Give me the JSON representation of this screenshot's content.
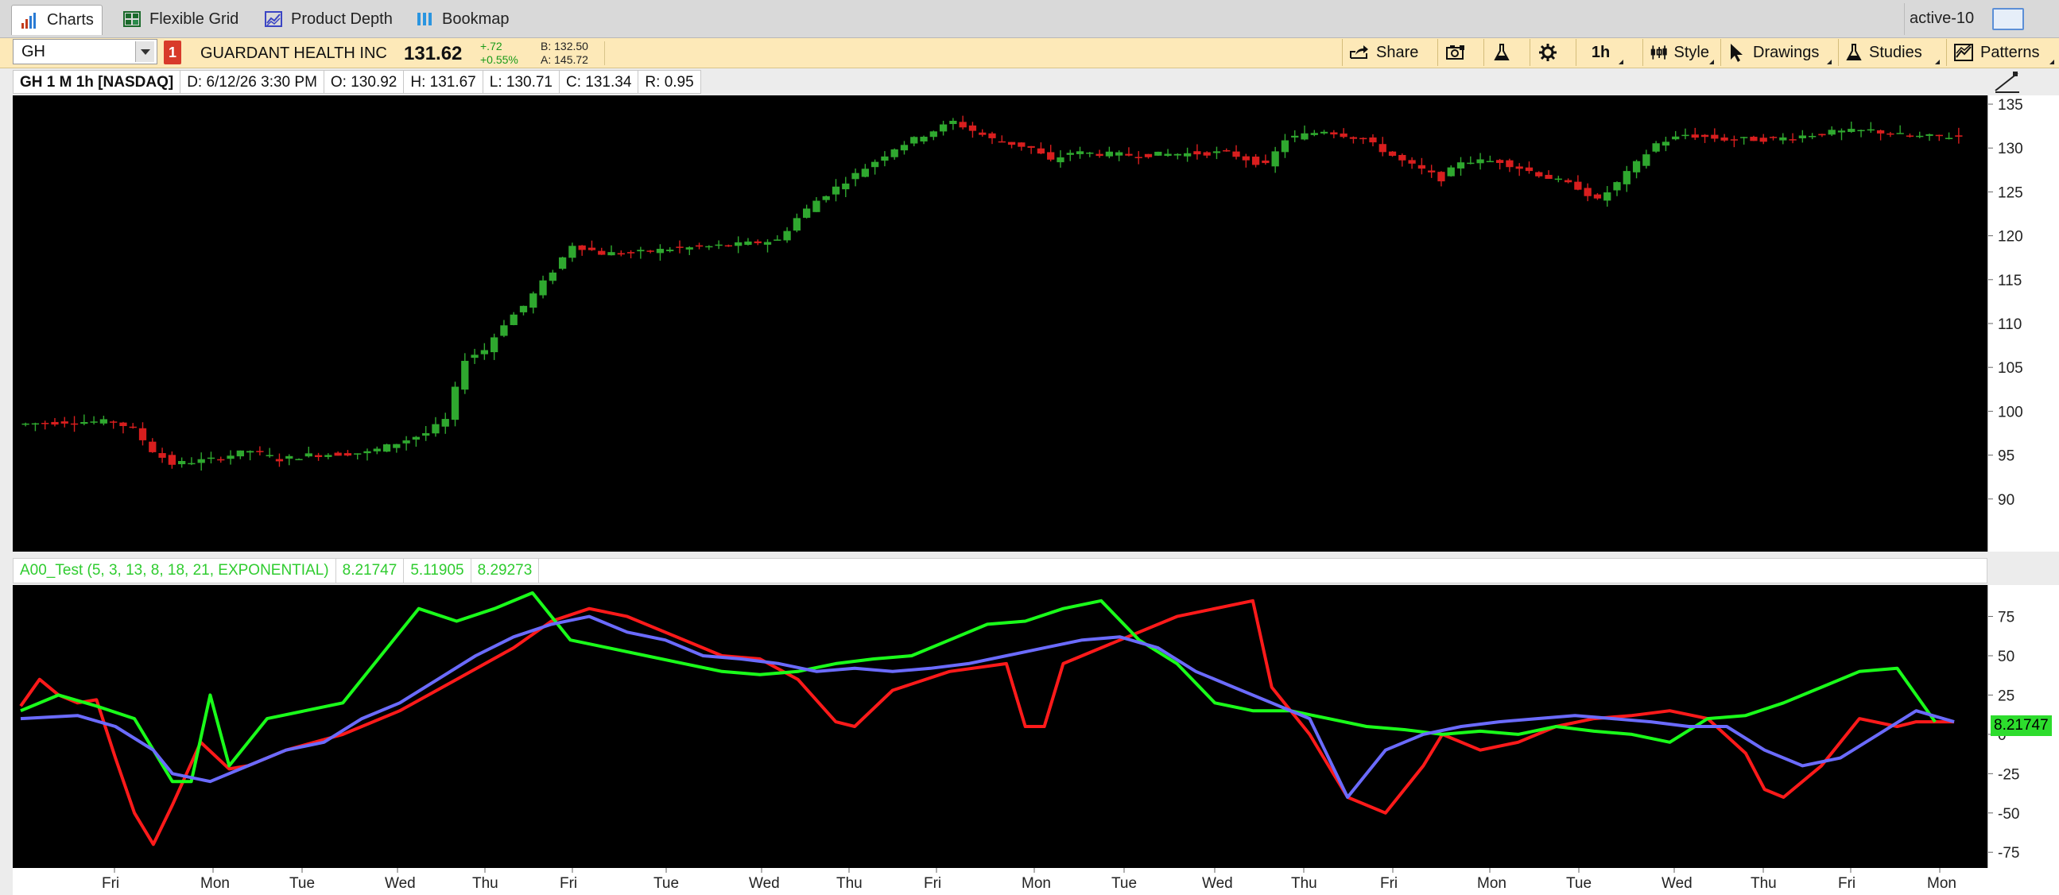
{
  "tabs": [
    {
      "label": "Charts",
      "icon": "bar-chart-icon",
      "active": true
    },
    {
      "label": "Flexible Grid",
      "icon": "grid-icon",
      "active": false
    },
    {
      "label": "Product Depth",
      "icon": "depth-icon",
      "active": false
    },
    {
      "label": "Bookmap",
      "icon": "bookmap-icon",
      "active": false
    }
  ],
  "workspace": {
    "label": "active-10"
  },
  "symbol": {
    "value": "GH",
    "link_badge": "1",
    "company": "GUARDANT HEALTH INC",
    "last": "131.62",
    "change_abs": "+.72",
    "change_pct": "+0.55%",
    "bid": "B: 132.50",
    "ask": "A: 145.72"
  },
  "toolbar": {
    "share": "Share",
    "timeframe": "1h",
    "style": "Style",
    "drawings": "Drawings",
    "studies": "Studies",
    "patterns": "Patterns"
  },
  "ohlc": {
    "title": "GH 1 M 1h [NASDAQ]",
    "date": "D: 6/12/26 3:30 PM",
    "open": "O: 130.92",
    "high": "H: 131.67",
    "low": "L: 130.71",
    "close": "C: 131.34",
    "range": "R: 0.95"
  },
  "study": {
    "name": "A00_Test (5, 3, 13, 8, 18, 21, EXPONENTIAL)",
    "v1": "8.21747",
    "v2": "5.11905",
    "v3": "8.29273",
    "current": "8.21747"
  },
  "colors": {
    "up": "#2fa82f",
    "down": "#d81e1e",
    "line_red": "#ff1a1a",
    "line_green": "#1aff1a",
    "line_blue": "#6b6bff"
  },
  "chart_data": [
    {
      "type": "candlestick",
      "title": "GH 1 M 1h [NASDAQ]",
      "ylim": [
        84,
        136
      ],
      "yticks": [
        90,
        95,
        100,
        105,
        110,
        115,
        120,
        125,
        130,
        135
      ],
      "x_labels": [
        "Fri",
        "Mon",
        "Tue",
        "Wed",
        "Thu",
        "Fri",
        "Tue",
        "Wed",
        "Thu",
        "Fri",
        "Mon",
        "Tue",
        "Wed",
        "Thu",
        "Fri",
        "Mon",
        "Tue",
        "Wed",
        "Thu",
        "Fri",
        "Mon"
      ],
      "anchors": [
        [
          0,
          98.5
        ],
        [
          5,
          98.8
        ],
        [
          10,
          98.8
        ],
        [
          12,
          98
        ],
        [
          14,
          95.5
        ],
        [
          16,
          94
        ],
        [
          20,
          94.5
        ],
        [
          24,
          95.5
        ],
        [
          27,
          94.5
        ],
        [
          30,
          95
        ],
        [
          36,
          95.3
        ],
        [
          38,
          96
        ],
        [
          42,
          97.5
        ],
        [
          44,
          99
        ],
        [
          46,
          106
        ],
        [
          48,
          107
        ],
        [
          50,
          110
        ],
        [
          52,
          112
        ],
        [
          55,
          116
        ],
        [
          57,
          119
        ],
        [
          60,
          118
        ],
        [
          63,
          118
        ],
        [
          67,
          118.5
        ],
        [
          70,
          118.7
        ],
        [
          74,
          119
        ],
        [
          78,
          119.5
        ],
        [
          80,
          122
        ],
        [
          82,
          124
        ],
        [
          86,
          127
        ],
        [
          90,
          130
        ],
        [
          93,
          131.5
        ],
        [
          96,
          133
        ],
        [
          100,
          131
        ],
        [
          104,
          130
        ],
        [
          106,
          128.5
        ],
        [
          108,
          129.5
        ],
        [
          114,
          129.2
        ],
        [
          118,
          129.3
        ],
        [
          124,
          129.5
        ],
        [
          128,
          128
        ],
        [
          130,
          131
        ],
        [
          134,
          132
        ],
        [
          138,
          131
        ],
        [
          142,
          128.5
        ],
        [
          146,
          126.5
        ],
        [
          148,
          128.5
        ],
        [
          152,
          128.5
        ],
        [
          156,
          127
        ],
        [
          160,
          125.5
        ],
        [
          162,
          124
        ],
        [
          164,
          126
        ],
        [
          168,
          130.5
        ],
        [
          171,
          131.5
        ],
        [
          175,
          131
        ],
        [
          180,
          131
        ],
        [
          186,
          131.8
        ],
        [
          190,
          132
        ],
        [
          194,
          131.3
        ],
        [
          198,
          131.3
        ]
      ],
      "n_bars": 199
    },
    {
      "type": "line",
      "title": "A00_Test (5, 3, 13, 8, 18, 21, EXPONENTIAL)",
      "ylim": [
        -85,
        95
      ],
      "yticks": [
        75,
        50,
        25,
        0,
        -25,
        -50,
        -75
      ],
      "series": [
        {
          "color": "line_red",
          "values": [
            [
              0,
              18
            ],
            [
              2,
              35
            ],
            [
              4,
              25
            ],
            [
              6,
              20
            ],
            [
              8,
              22
            ],
            [
              10,
              -15
            ],
            [
              12,
              -50
            ],
            [
              14,
              -70
            ],
            [
              16,
              -45
            ],
            [
              19,
              -5
            ],
            [
              22,
              -22
            ],
            [
              24,
              -20
            ],
            [
              28,
              -10
            ],
            [
              34,
              0
            ],
            [
              40,
              15
            ],
            [
              46,
              35
            ],
            [
              52,
              55
            ],
            [
              56,
              72
            ],
            [
              60,
              80
            ],
            [
              64,
              75
            ],
            [
              70,
              60
            ],
            [
              74,
              50
            ],
            [
              78,
              48
            ],
            [
              82,
              35
            ],
            [
              86,
              8
            ],
            [
              88,
              5
            ],
            [
              92,
              28
            ],
            [
              98,
              40
            ],
            [
              104,
              45
            ],
            [
              106,
              5
            ],
            [
              108,
              5
            ],
            [
              110,
              45
            ],
            [
              116,
              60
            ],
            [
              122,
              75
            ],
            [
              130,
              85
            ],
            [
              132,
              30
            ],
            [
              136,
              0
            ],
            [
              140,
              -40
            ],
            [
              144,
              -50
            ],
            [
              148,
              -20
            ],
            [
              150,
              0
            ],
            [
              154,
              -10
            ],
            [
              158,
              -5
            ],
            [
              162,
              5
            ],
            [
              166,
              10
            ],
            [
              170,
              12
            ],
            [
              174,
              15
            ],
            [
              178,
              10
            ],
            [
              182,
              -12
            ],
            [
              184,
              -35
            ],
            [
              186,
              -40
            ],
            [
              190,
              -20
            ],
            [
              194,
              10
            ],
            [
              198,
              5
            ],
            [
              200,
              8
            ],
            [
              204,
              8
            ]
          ]
        },
        {
          "color": "line_green",
          "values": [
            [
              0,
              15
            ],
            [
              4,
              25
            ],
            [
              8,
              18
            ],
            [
              12,
              10
            ],
            [
              16,
              -30
            ],
            [
              18,
              -30
            ],
            [
              20,
              25
            ],
            [
              22,
              -20
            ],
            [
              26,
              10
            ],
            [
              30,
              15
            ],
            [
              34,
              20
            ],
            [
              38,
              50
            ],
            [
              42,
              80
            ],
            [
              46,
              72
            ],
            [
              50,
              80
            ],
            [
              54,
              90
            ],
            [
              58,
              60
            ],
            [
              62,
              55
            ],
            [
              66,
              50
            ],
            [
              70,
              45
            ],
            [
              74,
              40
            ],
            [
              78,
              38
            ],
            [
              82,
              40
            ],
            [
              86,
              45
            ],
            [
              90,
              48
            ],
            [
              94,
              50
            ],
            [
              98,
              60
            ],
            [
              102,
              70
            ],
            [
              106,
              72
            ],
            [
              110,
              80
            ],
            [
              114,
              85
            ],
            [
              118,
              60
            ],
            [
              122,
              45
            ],
            [
              126,
              20
            ],
            [
              130,
              15
            ],
            [
              134,
              15
            ],
            [
              138,
              10
            ],
            [
              142,
              5
            ],
            [
              146,
              3
            ],
            [
              150,
              0
            ],
            [
              154,
              2
            ],
            [
              158,
              0
            ],
            [
              162,
              5
            ],
            [
              166,
              2
            ],
            [
              170,
              0
            ],
            [
              174,
              -5
            ],
            [
              178,
              10
            ],
            [
              182,
              12
            ],
            [
              186,
              20
            ],
            [
              190,
              30
            ],
            [
              194,
              40
            ],
            [
              198,
              42
            ],
            [
              202,
              8
            ]
          ]
        },
        {
          "color": "line_blue",
          "values": [
            [
              0,
              10
            ],
            [
              6,
              12
            ],
            [
              10,
              5
            ],
            [
              14,
              -10
            ],
            [
              16,
              -25
            ],
            [
              20,
              -30
            ],
            [
              24,
              -20
            ],
            [
              28,
              -10
            ],
            [
              32,
              -5
            ],
            [
              36,
              10
            ],
            [
              40,
              20
            ],
            [
              44,
              35
            ],
            [
              48,
              50
            ],
            [
              52,
              62
            ],
            [
              56,
              70
            ],
            [
              60,
              75
            ],
            [
              64,
              65
            ],
            [
              68,
              60
            ],
            [
              72,
              50
            ],
            [
              76,
              48
            ],
            [
              80,
              45
            ],
            [
              84,
              40
            ],
            [
              88,
              42
            ],
            [
              92,
              40
            ],
            [
              96,
              42
            ],
            [
              100,
              45
            ],
            [
              104,
              50
            ],
            [
              108,
              55
            ],
            [
              112,
              60
            ],
            [
              116,
              62
            ],
            [
              120,
              55
            ],
            [
              124,
              40
            ],
            [
              128,
              30
            ],
            [
              132,
              20
            ],
            [
              136,
              10
            ],
            [
              140,
              -40
            ],
            [
              144,
              -10
            ],
            [
              148,
              0
            ],
            [
              152,
              5
            ],
            [
              156,
              8
            ],
            [
              160,
              10
            ],
            [
              164,
              12
            ],
            [
              168,
              10
            ],
            [
              172,
              8
            ],
            [
              176,
              5
            ],
            [
              180,
              5
            ],
            [
              184,
              -10
            ],
            [
              188,
              -20
            ],
            [
              192,
              -15
            ],
            [
              196,
              0
            ],
            [
              200,
              15
            ],
            [
              204,
              8
            ]
          ]
        }
      ]
    }
  ]
}
